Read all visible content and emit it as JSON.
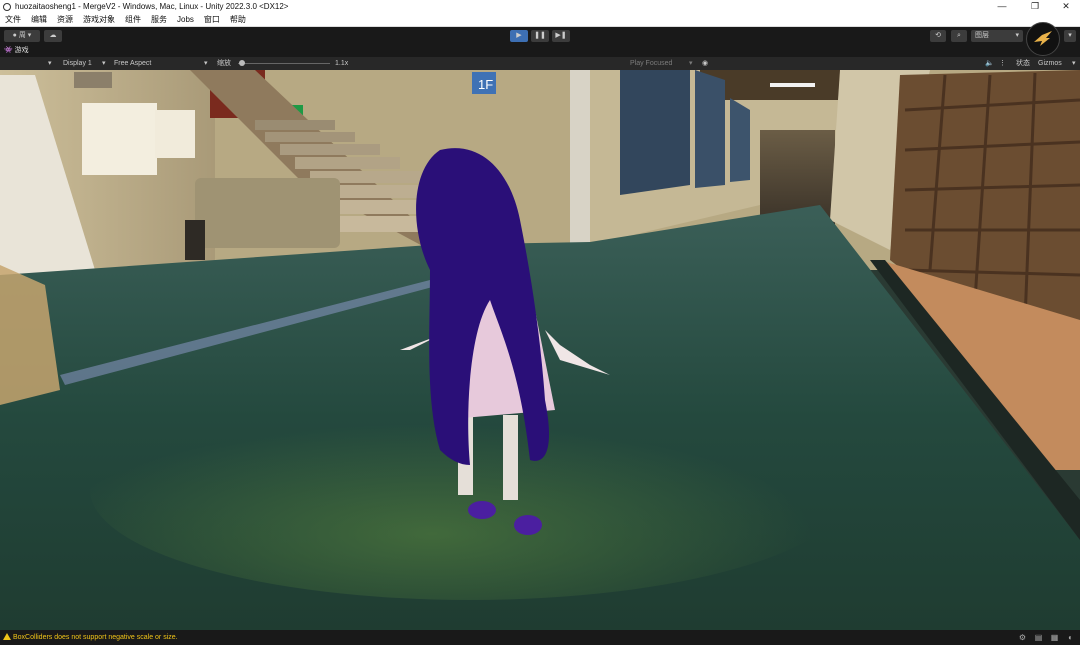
{
  "window": {
    "title": "huozaitaosheng1 - MergeV2 - Windows, Mac, Linux - Unity 2022.3.0 <DX12>",
    "minimize": "—",
    "maximize": "❐",
    "close": "✕"
  },
  "menu": [
    "文件",
    "编辑",
    "资源",
    "游戏对象",
    "组件",
    "服务",
    "Jobs",
    "窗口",
    "帮助"
  ],
  "toolbar": {
    "account_label": "周",
    "layout_label": "图层",
    "play_icon": "▶",
    "pause_icon": "❚❚",
    "step_icon": "▶❚"
  },
  "tab": {
    "label": "游戏"
  },
  "gamebar": {
    "display": "Display 1",
    "aspect": "Free Aspect",
    "scale_label": "缩放",
    "scale_value": "1.1x",
    "play_mode": "Play Focused",
    "stats": "状态",
    "gizmos": "Gizmos"
  },
  "status": {
    "message": "BoxColliders does not support negative scale or size."
  },
  "colors": {
    "accent": "#3d6fb3",
    "warning": "#f0c419",
    "editor_bg": "#191919",
    "hair": "#2a0f78",
    "dress": "#e7c9db"
  },
  "scene": {
    "sign_text": "1F"
  }
}
